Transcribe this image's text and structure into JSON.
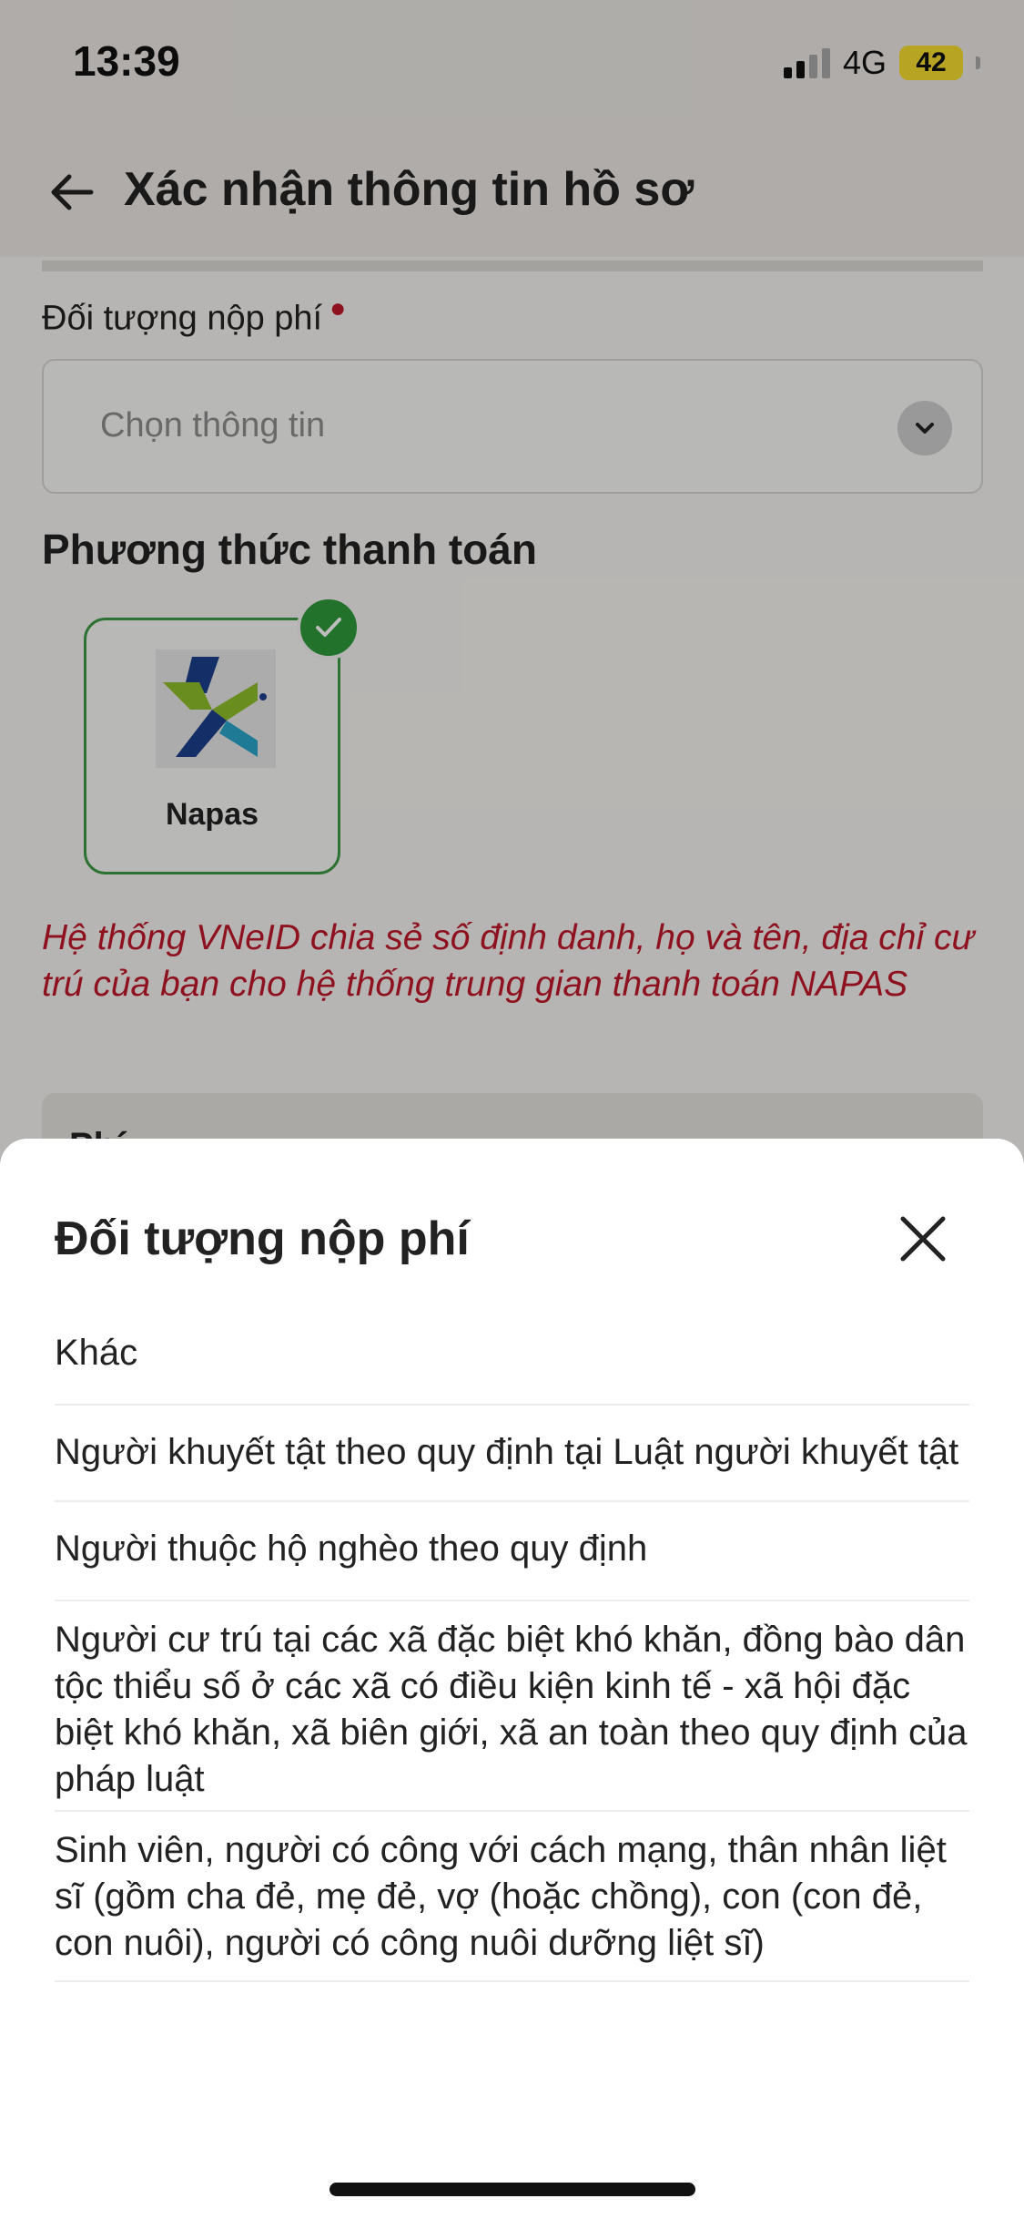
{
  "status_bar": {
    "time": "13:39",
    "network": "4G",
    "battery": "42"
  },
  "header": {
    "title": "Xác nhận thông tin hồ sơ",
    "back_icon": "arrow-left-icon"
  },
  "form": {
    "payer_label": "Đối tượng nộp phí",
    "payer_placeholder": "Chọn thông tin",
    "payment_section_title": "Phương thức thanh toán",
    "payment_method": "Napas",
    "notice": "Hệ thống VNeID chia sẻ số định danh, họ và tên, địa chỉ cư trú của bạn cho hệ thống trung gian thanh toán NAPAS",
    "fee_label": "Phí"
  },
  "sheet": {
    "title": "Đối tượng nộp phí",
    "close_icon": "close-icon",
    "options": [
      "Khác",
      "Người khuyết tật theo quy định tại Luật người khuyết tật",
      "Người thuộc hộ nghèo theo quy định",
      "Người cư trú tại các xã đặc biệt khó khăn, đồng bào dân tộc thiểu số ở các xã có điều kiện kinh tế - xã hội đặc biệt khó khăn, xã biên giới, xã an toàn theo quy định của pháp luật",
      "Sinh viên, người có công với cách mạng, thân nhân liệt sĩ (gồm cha đẻ, mẹ đẻ, vợ (hoặc chồng), con (con đẻ, con nuôi), người có công nuôi dưỡng liệt sĩ)"
    ]
  },
  "colors": {
    "accent_red": "#c0182a",
    "check_green": "#2f9a3c",
    "battery_yellow": "#f6de2e"
  }
}
